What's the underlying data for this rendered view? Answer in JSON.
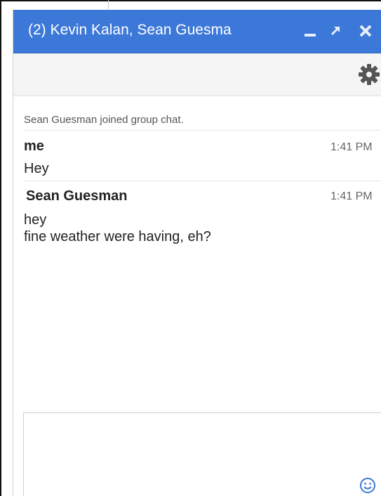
{
  "window": {
    "title_count": "(2)",
    "title_names": "Kevin Kalan, Sean Guesma",
    "accent_color": "#3c78d8",
    "controls": [
      "minimize-icon",
      "popout-icon",
      "close-icon"
    ]
  },
  "toolbar": {
    "settings_icon": "gear-icon"
  },
  "messages": {
    "system": "Sean Guesman joined group chat.",
    "groups": [
      {
        "sender": "me",
        "time": "1:41 PM",
        "lines": [
          "Hey"
        ]
      },
      {
        "sender": "Sean Guesman",
        "time": "1:41 PM",
        "lines": [
          "hey",
          "fine weather were having, eh?"
        ]
      }
    ]
  },
  "composer": {
    "value": "",
    "emoji_icon": "smiley-icon"
  }
}
